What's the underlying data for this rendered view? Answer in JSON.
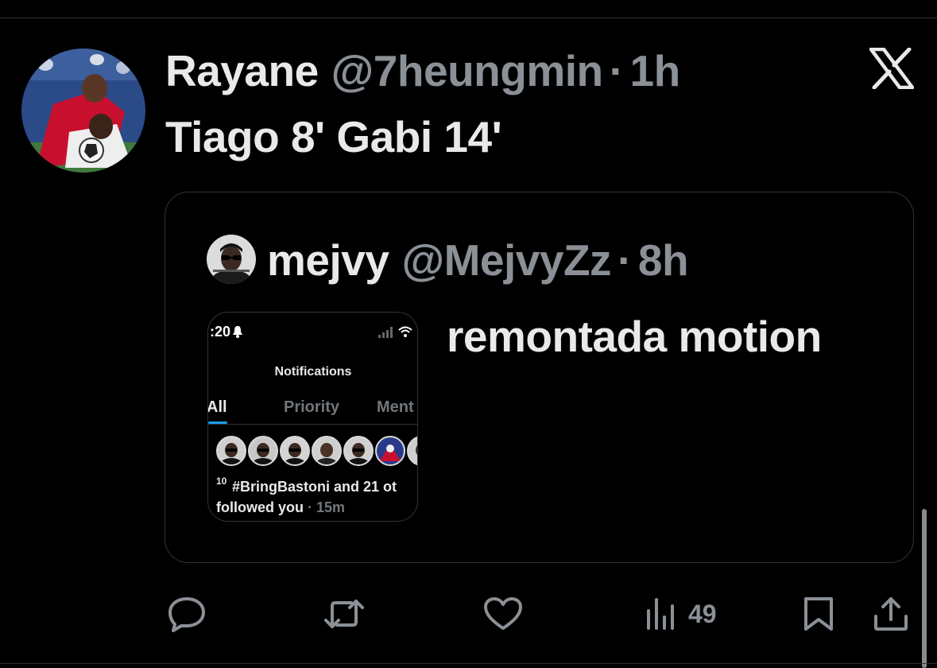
{
  "tweet": {
    "name": "Rayane",
    "handle": "@7heungmin",
    "separator": "·",
    "time": "1h",
    "text": "Tiago 8' Gabi 14'",
    "avatar_icon": "profile-photo-football-players"
  },
  "brand_icon": "x-logo-icon",
  "quote": {
    "name": "mejvy",
    "handle": "@MejvyZz",
    "separator": "·",
    "time": "8h",
    "text": "remontada motion",
    "media": {
      "status_time": ":20",
      "title": "Notifications",
      "tabs": [
        "All",
        "Priority",
        "Ment"
      ],
      "active_tab": "All",
      "count": "10",
      "line1": "#BringBastoni and 21 ot",
      "line2": "followed you",
      "line2_sep": " · ",
      "line2_time": "15m"
    }
  },
  "actions": {
    "reply_icon": "reply-icon",
    "retweet_icon": "retweet-icon",
    "like_icon": "heart-icon",
    "views_icon": "views-bar-chart-icon",
    "views_count": "49",
    "bookmark_icon": "bookmark-icon",
    "share_icon": "share-icon"
  },
  "colors": {
    "background": "#000000",
    "primary_text": "#e7e9ea",
    "secondary_text": "#8b9096",
    "border": "#2f3336",
    "accent": "#1d9bf0"
  }
}
